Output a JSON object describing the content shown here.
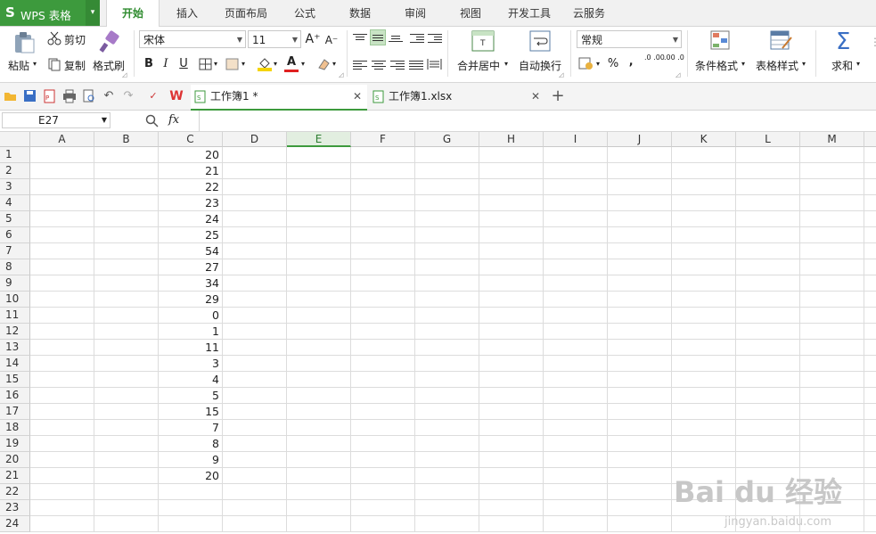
{
  "app": {
    "logo": "S",
    "title": "WPS 表格"
  },
  "menu_tabs": [
    "开始",
    "插入",
    "页面布局",
    "公式",
    "数据",
    "审阅",
    "视图",
    "开发工具",
    "云服务"
  ],
  "ribbon": {
    "paste": "粘贴",
    "cut": "剪切",
    "copy": "复制",
    "format_painter": "格式刷",
    "font_name": "宋体",
    "font_size": "11",
    "bold": "B",
    "italic": "I",
    "underline": "U",
    "merge_center": "合并居中",
    "wrap_text": "自动换行",
    "number_format": "常规",
    "percent": "%",
    "comma": "‚",
    "inc_decimal": ".0 .00",
    "dec_decimal": ".00 .0",
    "conditional_format": "条件格式",
    "table_style": "表格样式",
    "sum": "求和",
    "sum_symbol": "Σ",
    "font_grow": "A⁺",
    "font_shrink": "A⁻",
    "font_color_letter": "A"
  },
  "doc_tabs": [
    {
      "label": "工作簿1 *",
      "active": true
    },
    {
      "label": "工作簿1.xlsx",
      "active": false
    }
  ],
  "formula_bar": {
    "cell_ref": "E27",
    "fx": "fx",
    "value": ""
  },
  "columns": [
    "A",
    "B",
    "C",
    "D",
    "E",
    "F",
    "G",
    "H",
    "I",
    "J",
    "K",
    "L",
    "M"
  ],
  "selected_column": "E",
  "rows": [
    "1",
    "2",
    "3",
    "4",
    "5",
    "6",
    "7",
    "8",
    "9",
    "10",
    "11",
    "12",
    "13",
    "14",
    "15",
    "16",
    "17",
    "18",
    "19",
    "20",
    "21",
    "22",
    "23",
    "24"
  ],
  "column_c_values": [
    "20",
    "21",
    "22",
    "23",
    "24",
    "25",
    "54",
    "27",
    "34",
    "29",
    "0",
    "1",
    "11",
    "3",
    "4",
    "5",
    "15",
    "7",
    "8",
    "9",
    "20"
  ],
  "watermark": {
    "brand": "Bai du 经验",
    "url": "jingyan.baidu.com"
  },
  "colors": {
    "accent": "#3d9a3d",
    "selected_header": "#e2eee0"
  }
}
